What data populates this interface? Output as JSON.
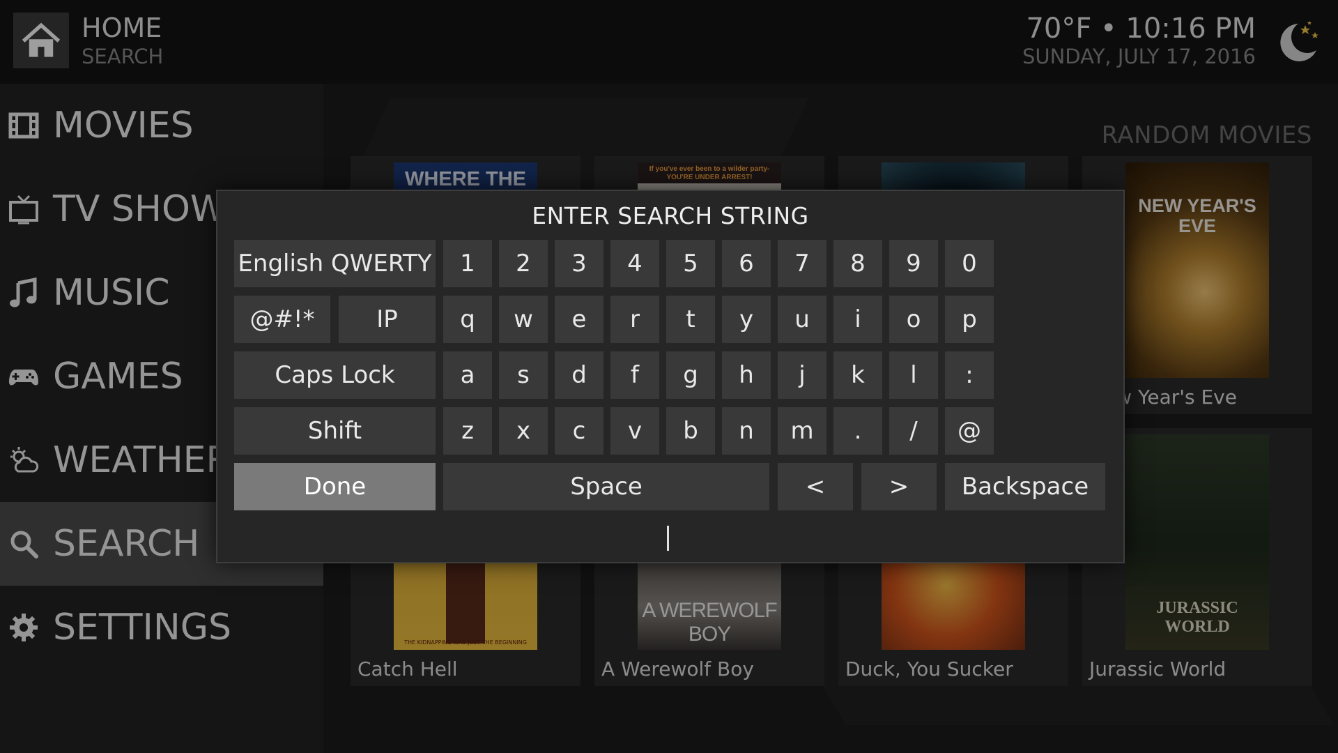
{
  "header": {
    "title": "HOME",
    "subtitle": "SEARCH",
    "time": "70°F • 10:16 PM",
    "date": "SUNDAY, JULY 17, 2016",
    "home_icon": "house-icon",
    "weather_icon": "moon-stars-icon"
  },
  "sidebar": {
    "items": [
      {
        "label": "MOVIES",
        "icon": "film-strip-icon"
      },
      {
        "label": "TV SHOWS",
        "icon": "tv-icon"
      },
      {
        "label": "MUSIC",
        "icon": "music-note-icon"
      },
      {
        "label": "GAMES",
        "icon": "gamepad-icon"
      },
      {
        "label": "WEATHER",
        "icon": "weather-icon"
      },
      {
        "label": "SEARCH",
        "icon": "search-icon",
        "active": true
      },
      {
        "label": "SETTINGS",
        "icon": "gear-icon"
      }
    ]
  },
  "random_movies": {
    "heading": "RANDOM MOVIES",
    "top_row": [
      {
        "title": "",
        "poster_text": "WHERE THE"
      },
      {
        "title": "",
        "poster_text": "If you've ever been to a wilder party- YOU'RE UNDER ARREST!"
      },
      {
        "title": "",
        "poster_text": ""
      },
      {
        "title": "New Year's Eve",
        "poster_text": "NEW YEAR'S EVE"
      }
    ],
    "bottom_row": [
      {
        "title": "Catch Hell",
        "poster_text": "THE KIDNAPPING WAS JUST THE BEGINNING"
      },
      {
        "title": "A Werewolf Boy",
        "poster_text": "A WEREWOLF BOY"
      },
      {
        "title": "Duck, You Sucker",
        "poster_text": ""
      },
      {
        "title": "Jurassic World",
        "poster_text": "JURASSIC WORLD"
      }
    ]
  },
  "keyboard": {
    "title": "ENTER SEARCH STRING",
    "layout_label": "English QWERTY",
    "symbols_label": "@#!*",
    "ip_label": "IP",
    "caps_label": "Caps Lock",
    "shift_label": "Shift",
    "done_label": "Done",
    "space_label": "Space",
    "left_label": "<",
    "right_label": ">",
    "backspace_label": "Backspace",
    "row1": [
      "1",
      "2",
      "3",
      "4",
      "5",
      "6",
      "7",
      "8",
      "9",
      "0"
    ],
    "row2": [
      "q",
      "w",
      "e",
      "r",
      "t",
      "y",
      "u",
      "i",
      "o",
      "p"
    ],
    "row3": [
      "a",
      "s",
      "d",
      "f",
      "g",
      "h",
      "j",
      "k",
      "l",
      ":"
    ],
    "row4": [
      "z",
      "x",
      "c",
      "v",
      "b",
      "n",
      "m",
      ".",
      "/",
      "@"
    ],
    "input_value": "",
    "focused_key": "Done"
  }
}
